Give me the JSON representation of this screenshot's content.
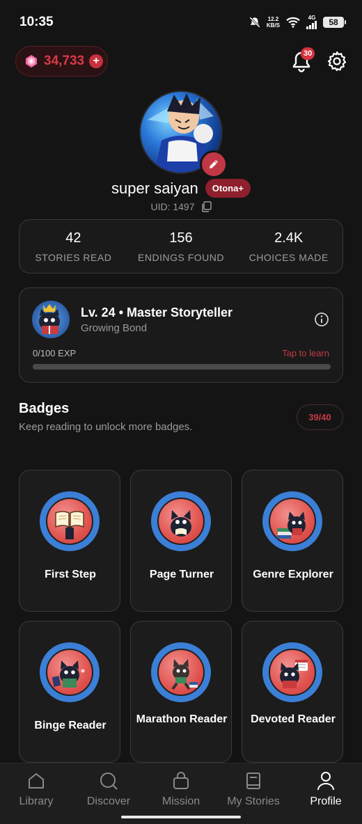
{
  "status_bar": {
    "time": "10:35",
    "net_speed_value": "12.2",
    "net_speed_unit": "KB/S",
    "network": "4G",
    "battery": "58"
  },
  "header": {
    "currency_value": "34,733",
    "currency_plus": "+",
    "notification_count": "30"
  },
  "profile": {
    "username": "super saiyan",
    "tier_badge": "Otona+",
    "uid_label": "UID: 1497"
  },
  "stats": [
    {
      "value": "42",
      "label": "STORIES READ"
    },
    {
      "value": "156",
      "label": "ENDINGS FOUND"
    },
    {
      "value": "2.4K",
      "label": "CHOICES MADE"
    }
  ],
  "level": {
    "title": "Lv. 24 • Master Storyteller",
    "subtitle": "Growing Bond",
    "exp_text": "0/100 EXP",
    "tap_to_learn": "Tap to learn",
    "progress": 0
  },
  "badges": {
    "title": "Badges",
    "subtitle": "Keep reading to unlock more badges.",
    "count": "39/40",
    "items": [
      {
        "label": "First Step",
        "icon": "book-hand-icon"
      },
      {
        "label": "Page Turner",
        "icon": "cat-reading-icon"
      },
      {
        "label": "Genre Explorer",
        "icon": "cat-books-icon"
      },
      {
        "label": "Binge Reader",
        "icon": "cat-binge-icon"
      },
      {
        "label": "Marathon Reader",
        "icon": "cat-running-icon"
      },
      {
        "label": "Devoted Reader",
        "icon": "cat-calendar-icon"
      }
    ]
  },
  "nav": [
    {
      "label": "Library",
      "icon": "house-icon"
    },
    {
      "label": "Discover",
      "icon": "search-icon"
    },
    {
      "label": "Mission",
      "icon": "bag-icon"
    },
    {
      "label": "My Stories",
      "icon": "book-icon"
    },
    {
      "label": "Profile",
      "icon": "person-icon",
      "active": true
    }
  ],
  "colors": {
    "accent": "#d23a47",
    "badge_ring": "#3b7fd6",
    "background": "#141414"
  }
}
